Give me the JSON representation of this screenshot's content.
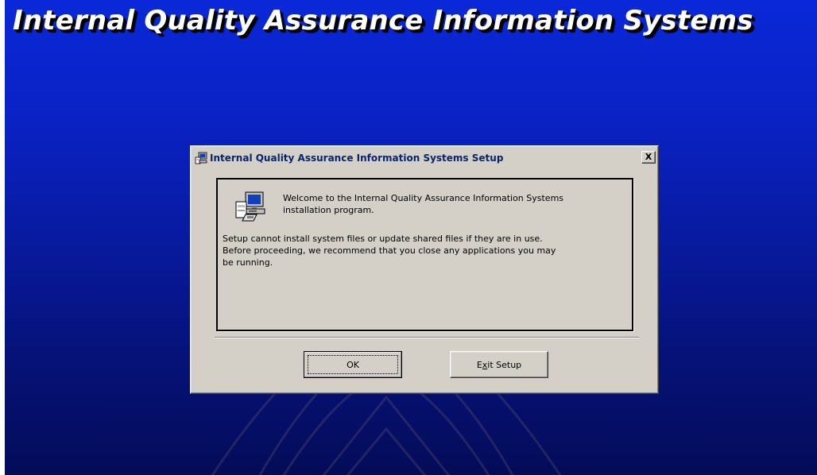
{
  "banner": {
    "title": "Internal Quality Assurance Information Systems"
  },
  "dialog": {
    "title": "Internal Quality Assurance Information Systems Setup",
    "close_label": "X",
    "welcome_line1": "Welcome to the Internal Quality Assurance Information Systems",
    "welcome_line2": "installation program.",
    "warning_line1": "Setup cannot install system files or update shared files if they are in use.",
    "warning_line2": "Before proceeding, we recommend that you close any applications you may",
    "warning_line3": "be running.",
    "ok_label": "OK",
    "exit_label_pre": "E",
    "exit_label_underlined": "x",
    "exit_label_post": "it Setup"
  },
  "icons": {
    "title": "setup-computer-icon",
    "setup": "setup-computer-icon",
    "background": "emblem-watermark"
  },
  "colors": {
    "background_top": "#0a28d8",
    "background_bottom": "#040c58",
    "dialog_face": "#d4d0c8",
    "title_text": "#0a246a"
  }
}
